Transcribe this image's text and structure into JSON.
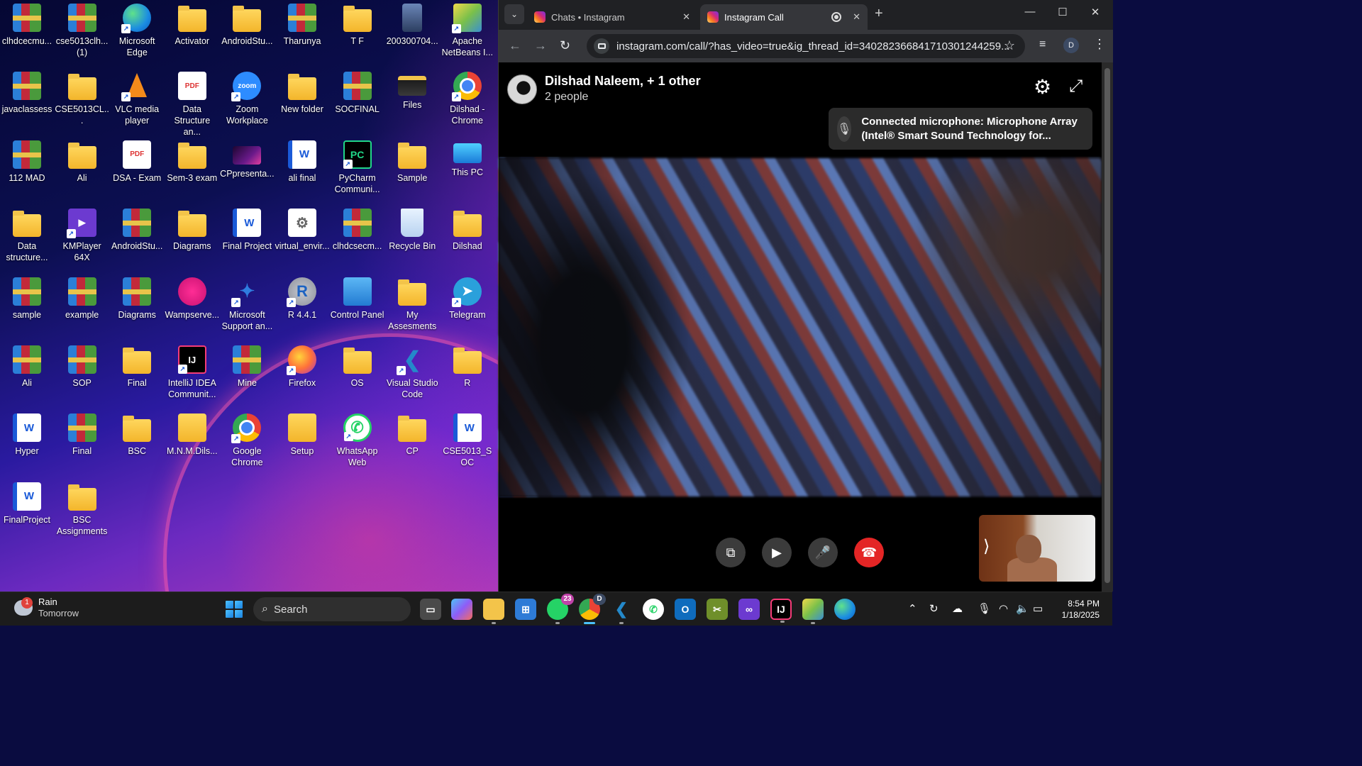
{
  "desktop": {
    "icons": [
      {
        "label": "clhdcecmu...",
        "icon": "winrar-icon"
      },
      {
        "label": "cse5013clh...\n(1)",
        "icon": "winrar-icon"
      },
      {
        "label": "Microsoft\nEdge",
        "icon": "edge-icon"
      },
      {
        "label": "Activator",
        "icon": "folder-icon"
      },
      {
        "label": "AndroidStu...",
        "icon": "folder-icon"
      },
      {
        "label": "Tharunya",
        "icon": "winrar-icon"
      },
      {
        "label": "T F",
        "icon": "folder-icon"
      },
      {
        "label": "200300704...",
        "icon": "photo-icon"
      },
      {
        "label": "Apache\nNetBeans I...",
        "icon": "netbeans-icon"
      },
      {
        "label": "javaclassess",
        "icon": "winrar-icon"
      },
      {
        "label": "CSE5013CL...",
        "icon": "folder-icon"
      },
      {
        "label": "VLC media\nplayer",
        "icon": "vlc-icon"
      },
      {
        "label": "Data\nStructure an...",
        "icon": "pdf-icon"
      },
      {
        "label": "Zoom\nWorkplace",
        "icon": "zoom-icon"
      },
      {
        "label": "New folder",
        "icon": "folder-icon"
      },
      {
        "label": "SOCFINAL",
        "icon": "winrar-icon"
      },
      {
        "label": "Files",
        "icon": "files-icon"
      },
      {
        "label": "Dilshad -\nChrome",
        "icon": "chrome-icon"
      },
      {
        "label": "112 MAD",
        "icon": "winrar-icon"
      },
      {
        "label": "Ali",
        "icon": "folder-icon"
      },
      {
        "label": "DSA - Exam",
        "icon": "pdf-icon"
      },
      {
        "label": "Sem-3 exam",
        "icon": "folder-icon"
      },
      {
        "label": "CPpresenta...",
        "icon": "presentation-icon"
      },
      {
        "label": "ali final",
        "icon": "word-icon"
      },
      {
        "label": "PyCharm\nCommuni...",
        "icon": "pycharm-icon"
      },
      {
        "label": "Sample",
        "icon": "folder-icon"
      },
      {
        "label": "This PC",
        "icon": "monitor-icon"
      },
      {
        "label": "Data\nstructure...",
        "icon": "folder-icon"
      },
      {
        "label": "KMPlayer 64X",
        "icon": "kmplayer-icon"
      },
      {
        "label": "AndroidStu...",
        "icon": "winrar-icon"
      },
      {
        "label": "Diagrams",
        "icon": "folder-icon"
      },
      {
        "label": "Final Project",
        "icon": "word-icon"
      },
      {
        "label": "virtual_envir...",
        "icon": "settings-file-icon"
      },
      {
        "label": "clhdcsecm...",
        "icon": "winrar-icon"
      },
      {
        "label": "Recycle Bin",
        "icon": "recycle-bin-icon"
      },
      {
        "label": "Dilshad",
        "icon": "folder-icon"
      },
      {
        "label": "sample",
        "icon": "winrar-icon"
      },
      {
        "label": "example",
        "icon": "winrar-icon"
      },
      {
        "label": "Diagrams",
        "icon": "winrar-icon"
      },
      {
        "label": "Wampserve...",
        "icon": "wampserver-icon"
      },
      {
        "label": "Microsoft\nSupport an...",
        "icon": "ms-support-icon"
      },
      {
        "label": "R 4.4.1",
        "icon": "r-icon"
      },
      {
        "label": "Control Panel",
        "icon": "control-panel-icon"
      },
      {
        "label": "My\nAssesments",
        "icon": "folder-icon"
      },
      {
        "label": "Telegram",
        "icon": "telegram-icon"
      },
      {
        "label": "Ali",
        "icon": "winrar-icon"
      },
      {
        "label": "SOP",
        "icon": "winrar-icon"
      },
      {
        "label": "Final",
        "icon": "folder-icon"
      },
      {
        "label": "IntelliJ IDEA\nCommunit...",
        "icon": "intellij-icon"
      },
      {
        "label": "Mine",
        "icon": "winrar-icon"
      },
      {
        "label": "Firefox",
        "icon": "firefox-icon"
      },
      {
        "label": "OS",
        "icon": "folder-icon"
      },
      {
        "label": "Visual Studio\nCode",
        "icon": "vscode-icon"
      },
      {
        "label": "R",
        "icon": "folder-icon"
      },
      {
        "label": "Hyper",
        "icon": "word-icon"
      },
      {
        "label": "Final",
        "icon": "winrar-icon"
      },
      {
        "label": "BSC",
        "icon": "folder-icon"
      },
      {
        "label": "M.N.M.Dils...",
        "icon": "user-folder-icon"
      },
      {
        "label": "Google\nChrome",
        "icon": "chrome-icon"
      },
      {
        "label": "Setup",
        "icon": "setup-icon"
      },
      {
        "label": "WhatsApp\nWeb",
        "icon": "whatsapp-icon"
      },
      {
        "label": "CP",
        "icon": "folder-icon"
      },
      {
        "label": "CSE5013_SOC",
        "icon": "word-icon"
      },
      {
        "label": "FinalProject",
        "icon": "word-icon"
      },
      {
        "label": "BSC\nAssignments",
        "icon": "folder-icon"
      }
    ]
  },
  "browser": {
    "tabs": [
      {
        "title": "Chats • Instagram",
        "active": false
      },
      {
        "title": "Instagram Call",
        "active": true
      }
    ],
    "url": "instagram.com/call/?has_video=true&ig_thread_id=340282366841710301244259...",
    "profile_initial": "D",
    "chrome_badge": "D"
  },
  "call": {
    "title": "Dilshad Naleem, + 1 other",
    "subtitle": "2 people",
    "toast": "Connected microphone: Microphone Array (Intel® Smart Sound Technology for..."
  },
  "taskbar": {
    "weather_title": "Rain",
    "weather_sub": "Tomorrow",
    "weather_badge": "1",
    "search_placeholder": "Search",
    "whatsapp_badge": "23",
    "time": "8:54 PM",
    "date": "1/18/2025"
  },
  "colors": {
    "end_call": "#e42525",
    "accent": "#4cc2ff",
    "instagram_gradient": "#d62976"
  }
}
